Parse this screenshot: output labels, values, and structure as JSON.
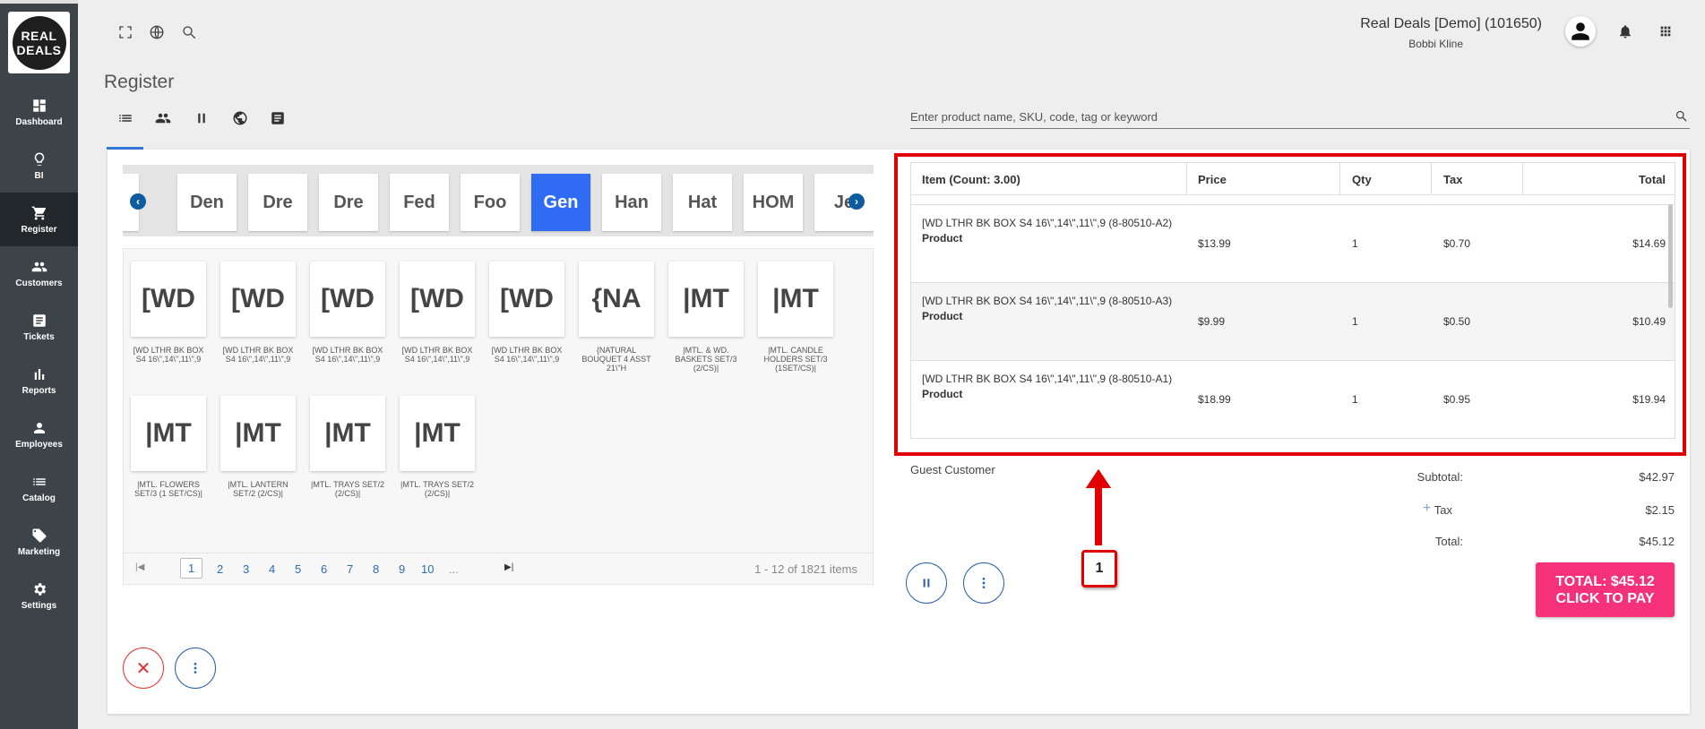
{
  "sidebar": {
    "logo_line1": "REAL",
    "logo_line2": "DEALS",
    "items": [
      {
        "label": "Dashboard"
      },
      {
        "label": "BI"
      },
      {
        "label": "Register"
      },
      {
        "label": "Customers"
      },
      {
        "label": "Tickets"
      },
      {
        "label": "Reports"
      },
      {
        "label": "Employees"
      },
      {
        "label": "Catalog"
      },
      {
        "label": "Marketing"
      },
      {
        "label": "Settings"
      }
    ]
  },
  "header": {
    "store": "Real Deals [Demo] (101650)",
    "user": "Bobbi Kline"
  },
  "page": {
    "title": "Register"
  },
  "search": {
    "placeholder": "Enter product name, SKU, code, tag or keyword"
  },
  "categories": [
    "",
    "Den",
    "Dre",
    "Dre",
    "Fed",
    "Foo",
    "Gen",
    "Han",
    "Hat",
    "HOM",
    "Je"
  ],
  "active_category_index": 6,
  "products": [
    {
      "tile": "[WD",
      "name": "[WD LTHR BK BOX S4 16\\\",14\\\",11\\\",9"
    },
    {
      "tile": "[WD",
      "name": "[WD LTHR BK BOX S4 16\\\",14\\\",11\\\",9"
    },
    {
      "tile": "[WD",
      "name": "[WD LTHR BK BOX S4 16\\\",14\\\",11\\\",9"
    },
    {
      "tile": "[WD",
      "name": "[WD LTHR BK BOX S4 16\\\",14\\\",11\\\",9"
    },
    {
      "tile": "[WD",
      "name": "[WD LTHR BK BOX S4 16\\\",14\\\",11\\\",9"
    },
    {
      "tile": "{NA",
      "name": "{NATURAL BOUQUET 4 ASST 21\\\"H"
    },
    {
      "tile": "|MT",
      "name": "|MTL. & WD. BASKETS SET/3 (2/CS)|"
    },
    {
      "tile": "|MT",
      "name": "|MTL. CANDLE HOLDERS SET/3 (1SET/CS)|"
    },
    {
      "tile": "|MT",
      "name": "|MTL. FLOWERS SET/3 (1 SET/CS)|"
    },
    {
      "tile": "|MT",
      "name": "|MTL. LANTERN SET/2 (2/CS)|"
    },
    {
      "tile": "|MT",
      "name": "|MTL. TRAYS SET/2 (2/CS)|"
    },
    {
      "tile": "|MT",
      "name": "|MTL. TRAYS SET/2 (2/CS)|"
    }
  ],
  "pager": {
    "pages": [
      "1",
      "2",
      "3",
      "4",
      "5",
      "6",
      "7",
      "8",
      "9",
      "10",
      "..."
    ],
    "info": "1 - 12 of 1821 items"
  },
  "cart": {
    "headers": {
      "item": "Item (Count: 3.00)",
      "price": "Price",
      "qty": "Qty",
      "tax": "Tax",
      "total": "Total"
    },
    "rows": [
      {
        "name": "[WD LTHR BK BOX S4 16\\\",14\\\",11\\\",9 (8-80510-A2)",
        "type": "Product",
        "price": "$13.99",
        "qty": "1",
        "tax": "$0.70",
        "total": "$14.69"
      },
      {
        "name": "[WD LTHR BK BOX S4 16\\\",14\\\",11\\\",9 (8-80510-A3)",
        "type": "Product",
        "price": "$9.99",
        "qty": "1",
        "tax": "$0.50",
        "total": "$10.49"
      },
      {
        "name": "[WD LTHR BK BOX S4 16\\\",14\\\",11\\\",9 (8-80510-A1)",
        "type": "Product",
        "price": "$18.99",
        "qty": "1",
        "tax": "$0.95",
        "total": "$19.94"
      }
    ],
    "customer": "Guest Customer",
    "subtotal_label": "Subtotal:",
    "subtotal": "$42.97",
    "tax_label": "Tax",
    "tax": "$2.15",
    "total_label": "Total:",
    "total": "$45.12",
    "pay_line1": "TOTAL: $45.12",
    "pay_line2": "CLICK TO PAY"
  },
  "callout": {
    "number": "1"
  },
  "colors": {
    "accent": "#2f6bf3",
    "pay": "#f5317a",
    "highlight": "#e00000",
    "sidebar": "#3d4449"
  }
}
